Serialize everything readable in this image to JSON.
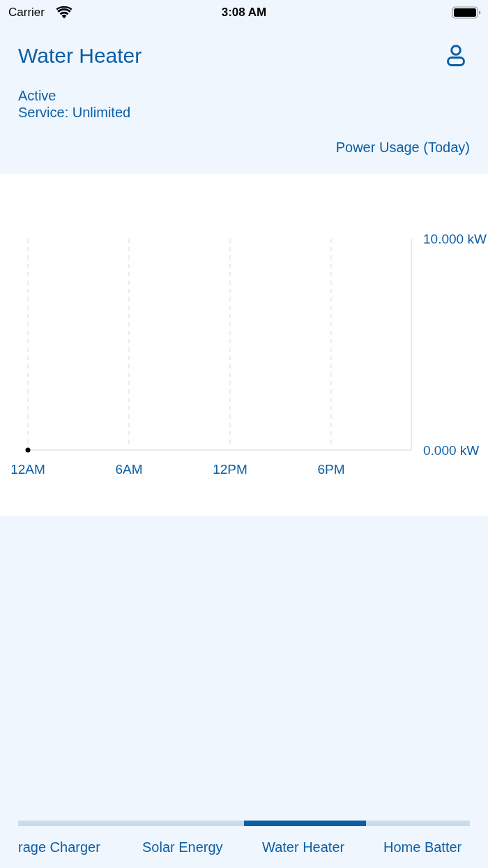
{
  "status_bar": {
    "carrier": "Carrier",
    "time": "3:08 AM"
  },
  "header": {
    "title": "Water Heater",
    "status": "Active",
    "service": "Service: Unlimited",
    "chart_label": "Power Usage (Today)"
  },
  "chart": {
    "chart_data": {
      "type": "line",
      "categories": [
        "12AM",
        "6AM",
        "12PM",
        "6PM"
      ],
      "values": [
        0,
        null,
        null,
        null
      ],
      "ylim": [
        0,
        10
      ],
      "yticks": [
        {
          "value": 0,
          "label": "0.000 kW"
        },
        {
          "value": 10,
          "label": "10.000 kW"
        }
      ],
      "grid": true,
      "marker": true
    }
  },
  "tabs": [
    {
      "label": "rage Charger",
      "selected": false
    },
    {
      "label": "Solar Energy",
      "selected": false
    },
    {
      "label": "Water Heater",
      "selected": true
    },
    {
      "label": "Home Batter",
      "selected": false
    }
  ]
}
